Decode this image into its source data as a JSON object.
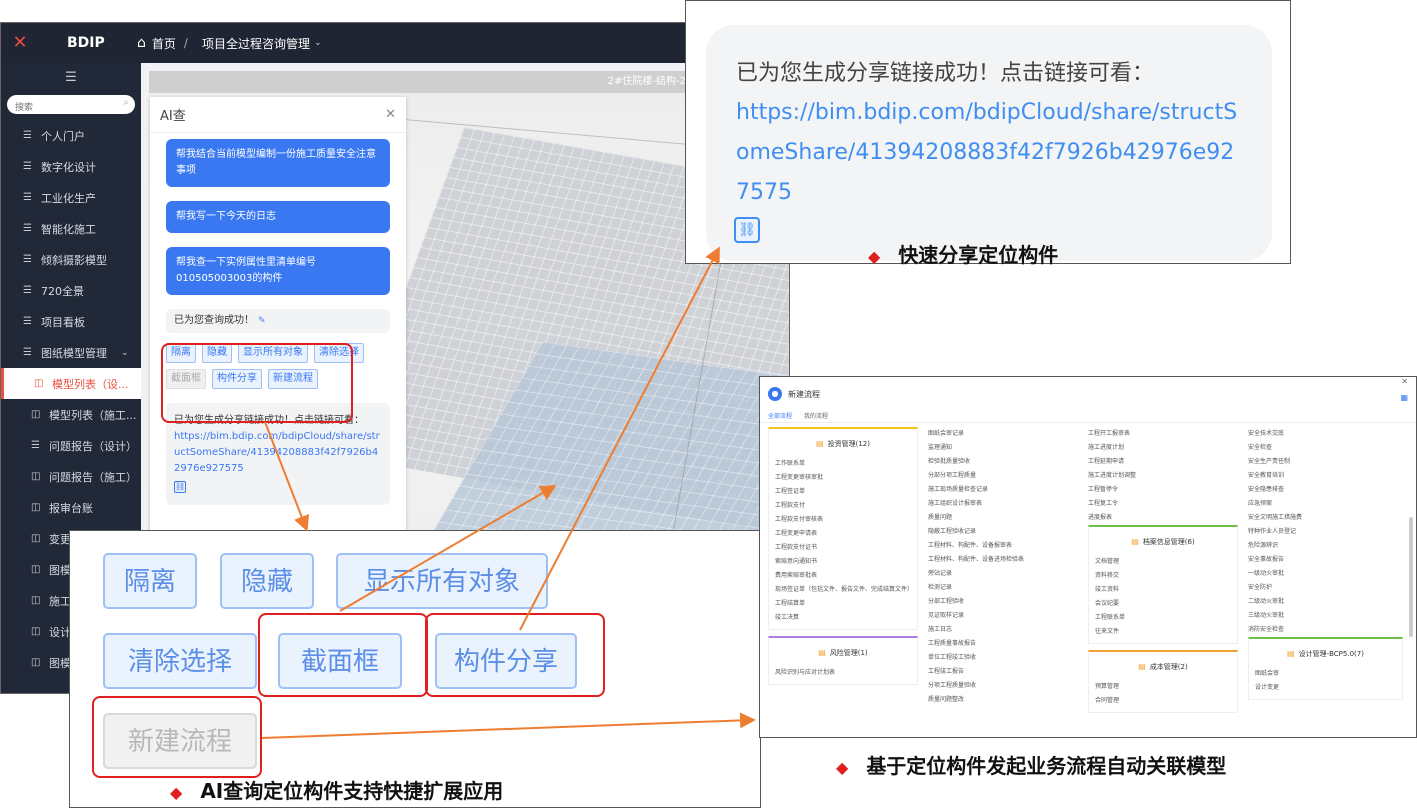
{
  "topbar": {
    "brand": "BDIP",
    "home": "首页",
    "breadcrumb": "项目全过程咨询管理"
  },
  "sidebar": {
    "search_placeholder": "搜索",
    "items": [
      {
        "label": "个人门户"
      },
      {
        "label": "数字化设计"
      },
      {
        "label": "工业化生产"
      },
      {
        "label": "智能化施工"
      },
      {
        "label": "倾斜摄影模型"
      },
      {
        "label": "720全景"
      },
      {
        "label": "项目看板"
      },
      {
        "label": "图纸模型管理"
      }
    ],
    "sub_items": [
      {
        "label": "模型列表（设..."
      },
      {
        "label": "模型列表（施工..."
      },
      {
        "label": "问题报告（设计）"
      },
      {
        "label": "问题报告（施工）"
      },
      {
        "label": "报审台账"
      },
      {
        "label": "变更"
      },
      {
        "label": "图模"
      },
      {
        "label": "施工"
      },
      {
        "label": "设计"
      },
      {
        "label": "图模"
      }
    ]
  },
  "viewport": {
    "title": "2#住院楼-结构-2"
  },
  "ai_panel": {
    "title": "AI查",
    "messages": [
      "帮我结合当前模型编制一份施工质量安全注意事项",
      "帮我写一下今天的日志",
      "帮我查一下实例属性里清单编号010505003003的构件"
    ],
    "result": "已为您查询成功！",
    "chips": [
      "隔离",
      "隐藏",
      "显示所有对象",
      "清除选择",
      "截面框",
      "构件分享",
      "新建流程"
    ],
    "share_text": "已为您生成分享链接成功！点击链接可看：",
    "share_link": "https://bim.bdip.com/bdipCloud/share/structSomeShare/41394208883f42f7926b42976e927575"
  },
  "callouts": {
    "chips_caption": "AI查询定位构件支持快捷扩展应用",
    "share_caption": "快速分享定位构件",
    "workflow_caption": "基于定位构件发起业务流程自动关联模型"
  },
  "workflow": {
    "title": "新建流程",
    "tabs": [
      "全部流程",
      "我的流程"
    ],
    "card1_title": "投资管理(12)",
    "card1_items": [
      "工作联系单",
      "工程变更审核审批",
      "工程签证单",
      "工程款支付",
      "工程款支付审核表",
      "工程变更申请表",
      "工程款支付证书",
      "索赔意向通知书",
      "费用索赔审批表",
      "现场签证单（包括文件、报告文件、完成结算文件）",
      "工程结算单",
      "竣工决算"
    ],
    "card2_title": "风险管理(1)",
    "card2_items": [
      "风险识别与应对计划表"
    ],
    "col2_items": [
      "图纸会审记录",
      "监理通知",
      "检验批质量验收",
      "分部分项工程质量",
      "施工现场质量检查记录",
      "施工组织设计报审表",
      "质量问题",
      "隐蔽工程验收记录",
      "工程材料、构配件、设备报审表",
      "工程材料、构配件、设备进场检验表",
      "旁站记录",
      "检测记录",
      "分部工程验收",
      "见证取样记录",
      "施工日志",
      "工程质量事故报告",
      "单位工程竣工验收",
      "工程竣工报告",
      "分项工程质量验收",
      "质量问题整改"
    ],
    "col3_items": [
      "工程开工报审表",
      "施工进度计划",
      "工程延期申请",
      "施工进度计划调整",
      "工程暂停令",
      "工程复工令",
      "进度报表"
    ],
    "card3_title": "档案信息管理(6)",
    "card3_items": [
      "文档管理",
      "资料移交",
      "竣工资料",
      "会议纪要",
      "工程联系单",
      "往来文件"
    ],
    "card4_title": "成本管理(2)",
    "card4_items": [
      "预算管理",
      "合同管理"
    ],
    "col4_items": [
      "安全技术交底",
      "安全检查",
      "安全生产责任制",
      "安全教育培训",
      "安全隐患排查",
      "应急预案",
      "安全文明施工措施费",
      "特种作业人员登记",
      "危险源辨识",
      "安全事故报告",
      "一级动火审批",
      "安全防护",
      "二级动火审批",
      "三级动火审批",
      "消防安全检查"
    ],
    "card5_title": "设计管理-BCP5.0(7)",
    "card5_items": [
      "图纸会审",
      "设计变更"
    ]
  }
}
